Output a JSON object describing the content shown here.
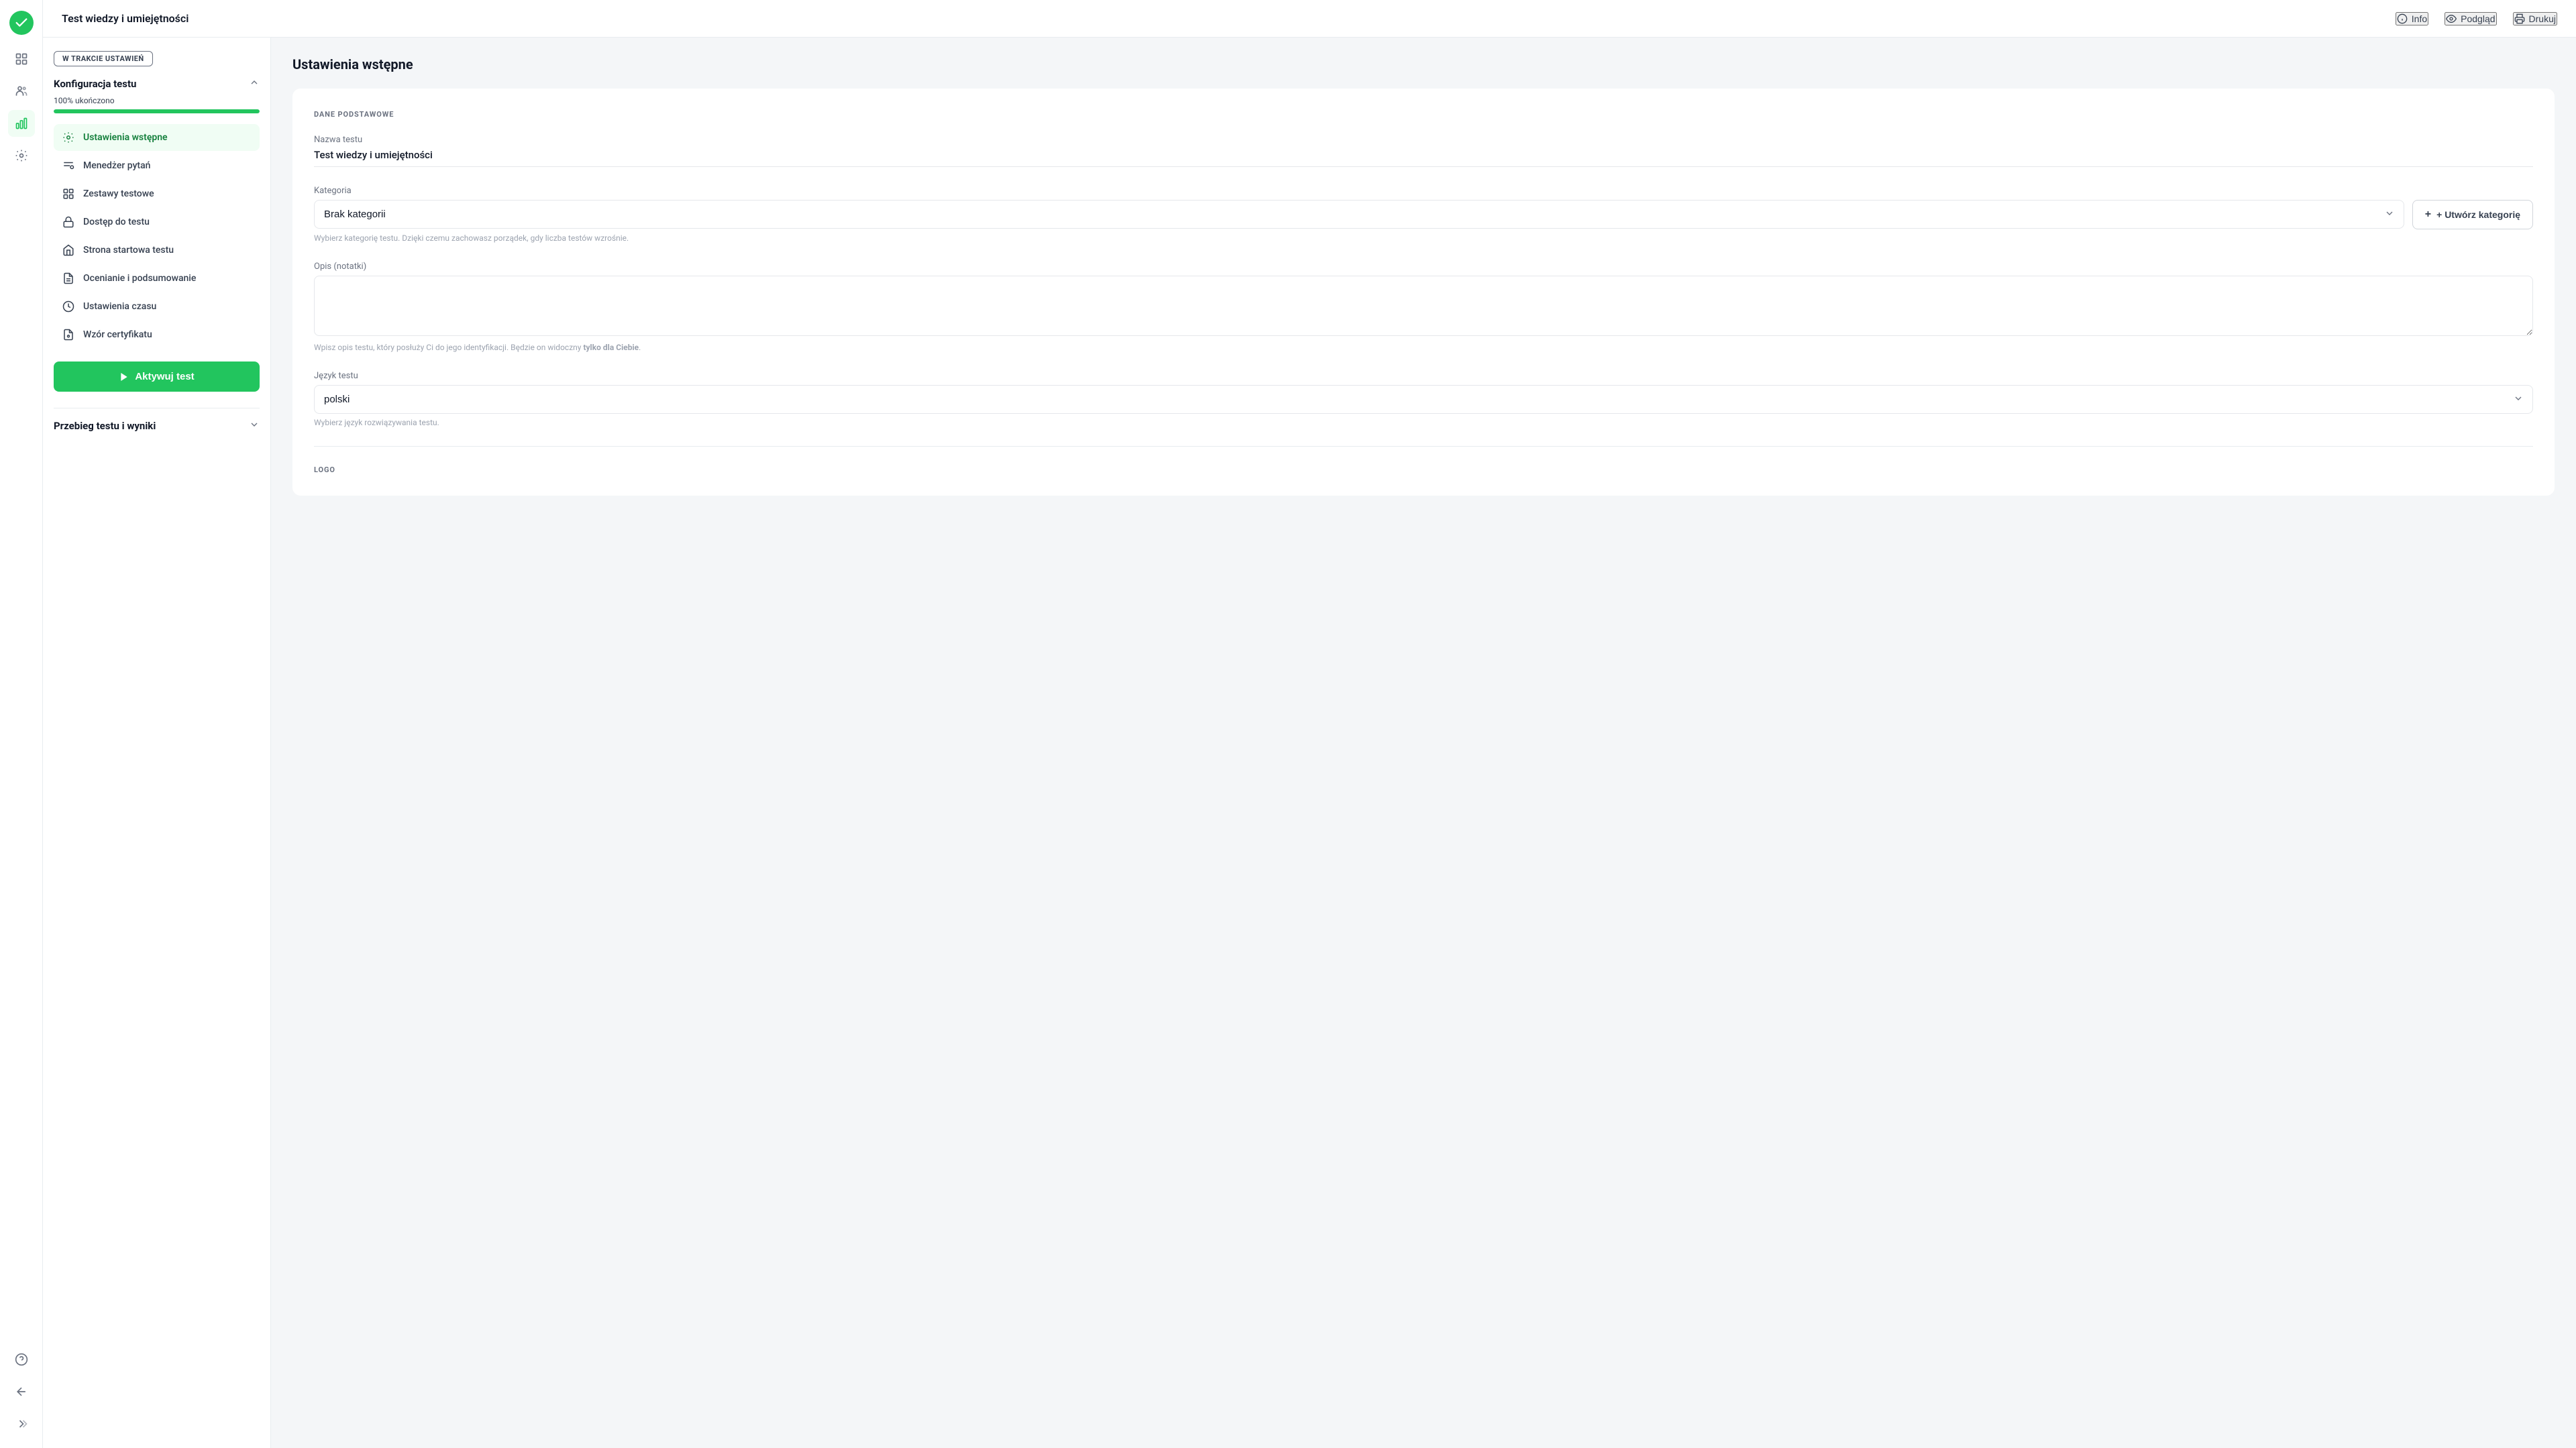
{
  "app": {
    "title": "Test wiedzy i umiejętności"
  },
  "header": {
    "page_title": "Test wiedzy i umiejętności",
    "actions": [
      {
        "id": "info",
        "label": "Info"
      },
      {
        "id": "preview",
        "label": "Podgląd"
      },
      {
        "id": "print",
        "label": "Drukuj"
      }
    ]
  },
  "sidebar": {
    "status_badge": "W TRAKCIE USTAWIEŃ",
    "section1_title": "Konfiguracja testu",
    "progress_label": "100% ukończono",
    "progress_value": 100,
    "menu_items": [
      {
        "id": "ustawienia-wstepne",
        "label": "Ustawienia wstępne",
        "active": true
      },
      {
        "id": "menedzer-pytan",
        "label": "Menedżer pytań",
        "active": false
      },
      {
        "id": "zestawy-testowe",
        "label": "Zestawy testowe",
        "active": false
      },
      {
        "id": "dostep-do-testu",
        "label": "Dostęp do testu",
        "active": false
      },
      {
        "id": "strona-startowa-testu",
        "label": "Strona startowa testu",
        "active": false
      },
      {
        "id": "ocenianie-i-podsumowanie",
        "label": "Ocenianie i podsumowanie",
        "active": false
      },
      {
        "id": "ustawienia-czasu",
        "label": "Ustawienia czasu",
        "active": false
      },
      {
        "id": "wzor-certyfikatu",
        "label": "Wzór certyfikatu",
        "active": false
      }
    ],
    "activate_btn_label": "Aktywuj test",
    "section2_title": "Przebieg testu i wyniki"
  },
  "main": {
    "content_title": "Ustawienia wstępne",
    "section_label": "DANE PODSTAWOWE",
    "fields": {
      "test_name_label": "Nazwa testu",
      "test_name_value": "Test wiedzy i umiejętności",
      "category_label": "Kategoria",
      "category_value": "Brak kategorii",
      "category_hint": "Wybierz kategorię testu. Dzięki czemu zachowasz porządek, gdy liczba testów wzrośnie.",
      "create_category_label": "+ Utwórz kategorię",
      "description_label": "Opis (notatki)",
      "description_hint_prefix": "Wpisz opis testu, który posłuży Ci do jego identyfikacji. Będzie on widoczny ",
      "description_hint_bold": "tylko dla Ciebie",
      "description_hint_suffix": ".",
      "language_label": "Język testu",
      "language_value": "polski",
      "language_hint": "Wybierz język rozwiązywania testu."
    },
    "logo_section_label": "LOGO"
  },
  "icons": {
    "check_circle": "✓",
    "chevron_down": "▾",
    "chevron_up": "▴",
    "play": "▶",
    "info": "ℹ",
    "eye": "◉",
    "printer": "⎙",
    "grid": "⊞",
    "users": "👥",
    "chart": "📊",
    "settings": "⚙",
    "question": "?",
    "arrow_left": "←",
    "chevrons_right": "»"
  },
  "colors": {
    "accent": "#22c55e",
    "accent_dark": "#16a34a",
    "text_primary": "#111827",
    "text_secondary": "#374151",
    "text_muted": "#6b7280",
    "border": "#e5e7eb",
    "bg_light": "#f4f6f8"
  }
}
